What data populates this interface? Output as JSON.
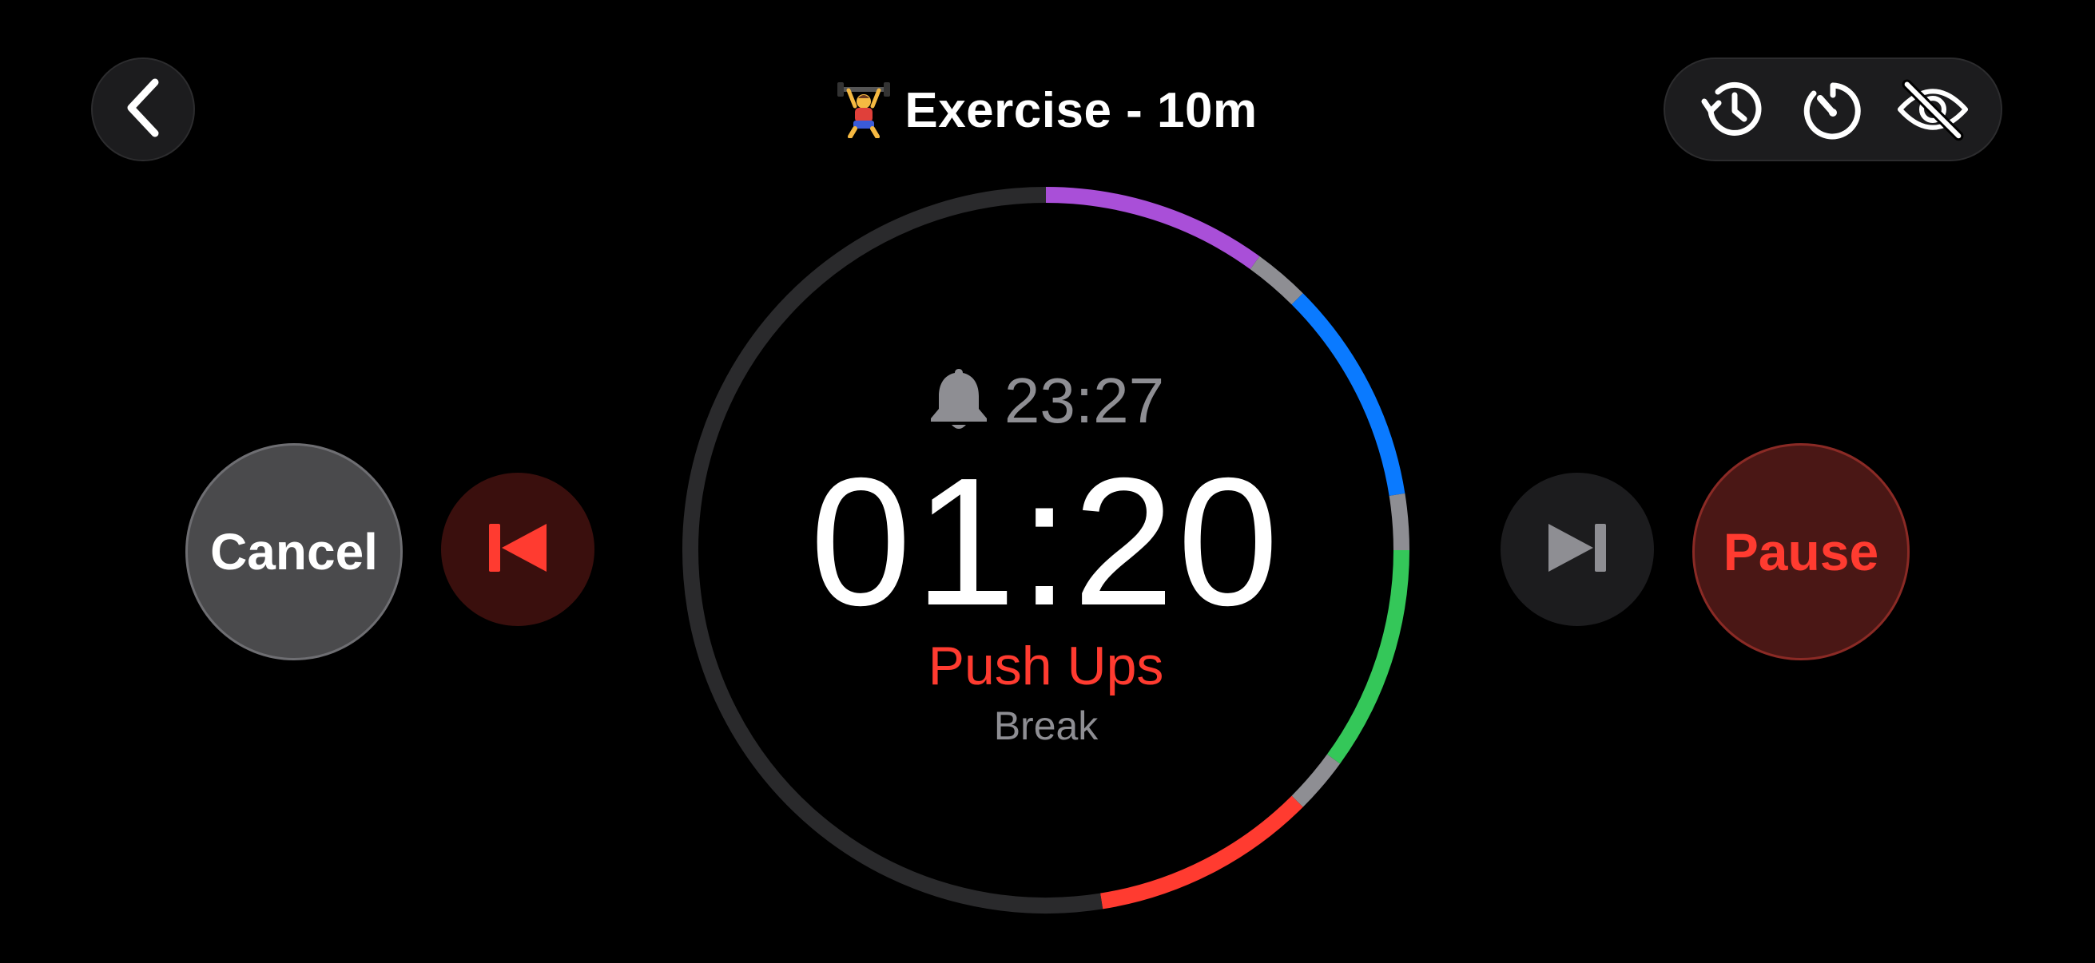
{
  "header": {
    "title": "Exercise - 10m",
    "title_emoji": "weightlifter-emoji",
    "back_icon": "chevron-left-icon"
  },
  "toolbar": {
    "icons": [
      "history-icon",
      "timer-icon",
      "eye-slash-icon"
    ]
  },
  "timer": {
    "alarm_icon": "bell-icon",
    "alarm_time": "23:27",
    "remaining": "01:20",
    "exercise_name": "Push Ups",
    "next_label": "Break"
  },
  "controls": {
    "cancel_label": "Cancel",
    "pause_label": "Pause",
    "previous_icon": "skip-back-icon",
    "next_icon": "skip-forward-icon"
  },
  "ring": {
    "segments": [
      {
        "color": "#a94fd8",
        "fraction": 0.1
      },
      {
        "color": "#8e8e93",
        "fraction": 0.025
      },
      {
        "color": "#0a7aff",
        "fraction": 0.1
      },
      {
        "color": "#8e8e93",
        "fraction": 0.025
      },
      {
        "color": "#34c759",
        "fraction": 0.1
      },
      {
        "color": "#8e8e93",
        "fraction": 0.025
      },
      {
        "color": "#ff3b30",
        "fraction": 0.1
      },
      {
        "color": "#2a2a2c",
        "fraction": 0.525
      }
    ]
  },
  "colors": {
    "accent_red": "#ff3b30",
    "secondary_text": "#8e8e93",
    "background": "#000000"
  }
}
